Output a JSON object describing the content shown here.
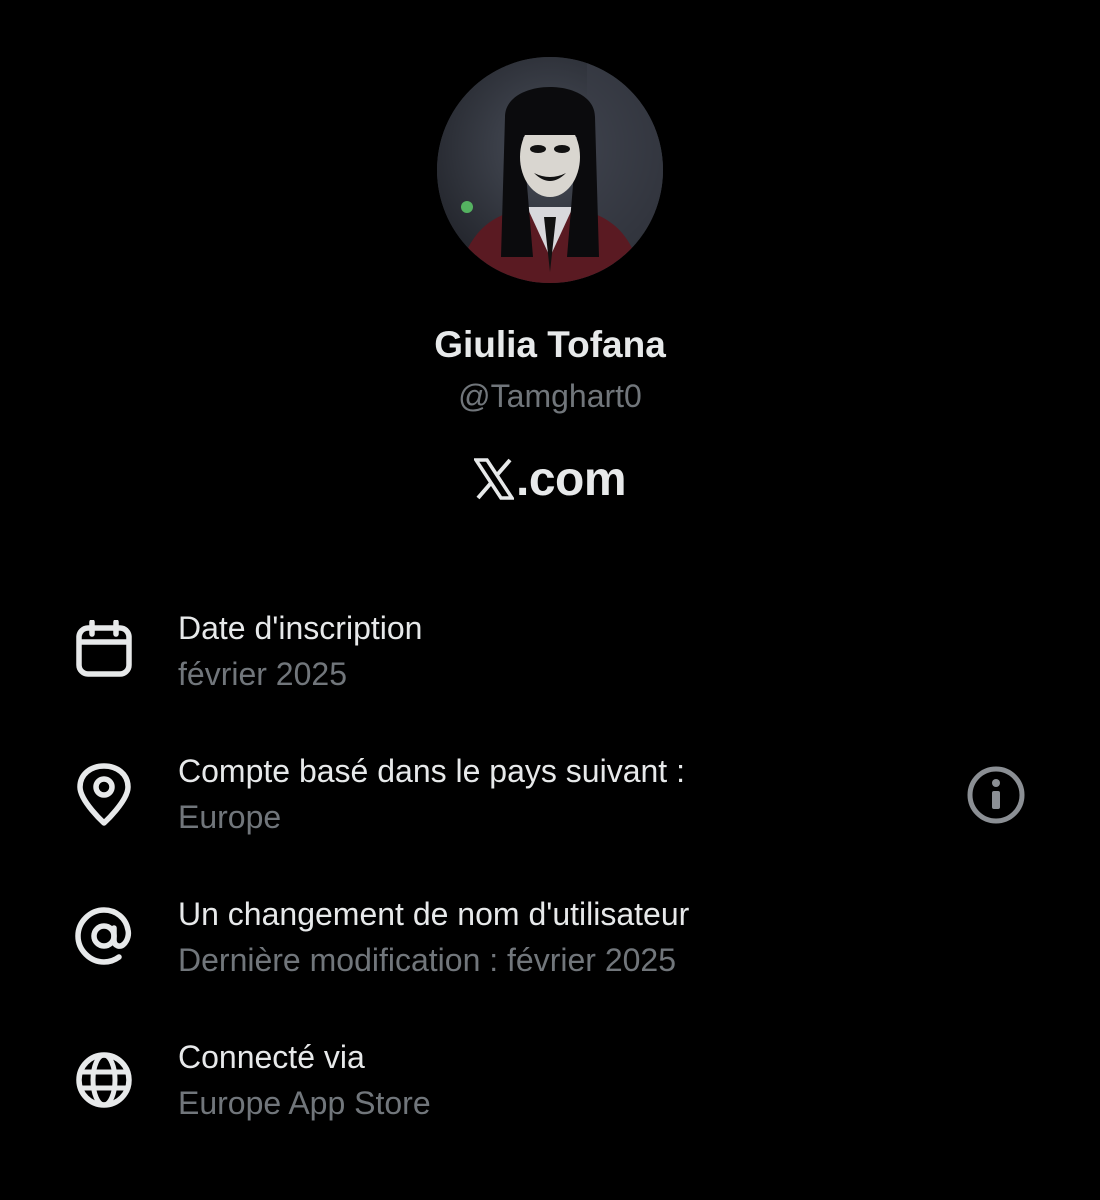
{
  "profile": {
    "display_name": "Giulia Tofana",
    "handle": "@Tamghart0",
    "avatar_icon": "masked-figure-avatar"
  },
  "brand": {
    "logo_icon": "x-logo-icon",
    "suffix": ".com"
  },
  "rows": [
    {
      "icon": "calendar-icon",
      "title": "Date d'inscription",
      "subtitle": "février 2025"
    },
    {
      "icon": "location-pin-icon",
      "title": "Compte basé dans le pays suivant :",
      "subtitle": "Europe",
      "action_icon": "info-icon"
    },
    {
      "icon": "at-sign-icon",
      "title": "Un changement de nom d'utilisateur",
      "subtitle": "Dernière modification : février 2025"
    },
    {
      "icon": "globe-icon",
      "title": "Connecté via",
      "subtitle": "Europe App Store"
    }
  ],
  "colors": {
    "background": "#000000",
    "primary_text": "#e7e9ea",
    "secondary_text": "#71767b"
  }
}
